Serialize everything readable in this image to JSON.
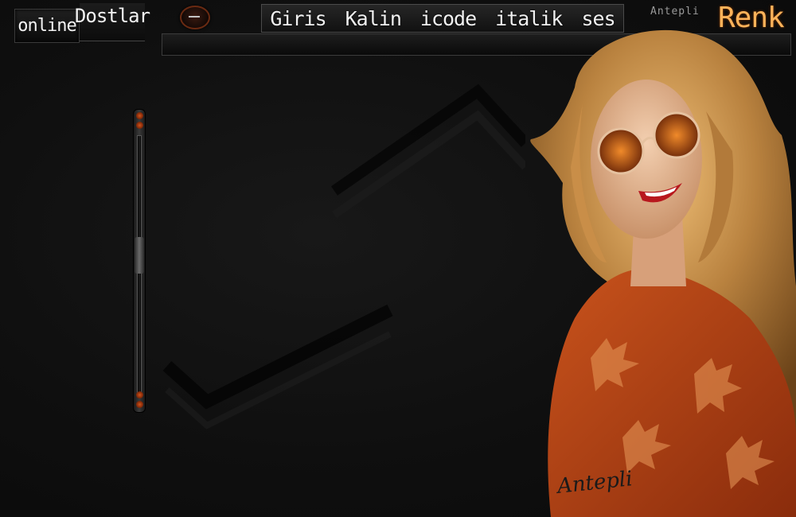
{
  "tabs": {
    "online_label": "online",
    "friends_label": "Dostlar"
  },
  "menu": {
    "items": [
      {
        "label": "Giris"
      },
      {
        "label": "Kalin"
      },
      {
        "label": "icode"
      },
      {
        "label": "italik"
      },
      {
        "label": "ses"
      }
    ]
  },
  "brand": {
    "small_label": "Antepli",
    "color_button_label": "Renk"
  },
  "photo": {
    "signature": "Antepli"
  },
  "colors": {
    "accent": "#ffb35a",
    "background": "#0d0d0d",
    "scroll_dot": "#d0541a"
  }
}
